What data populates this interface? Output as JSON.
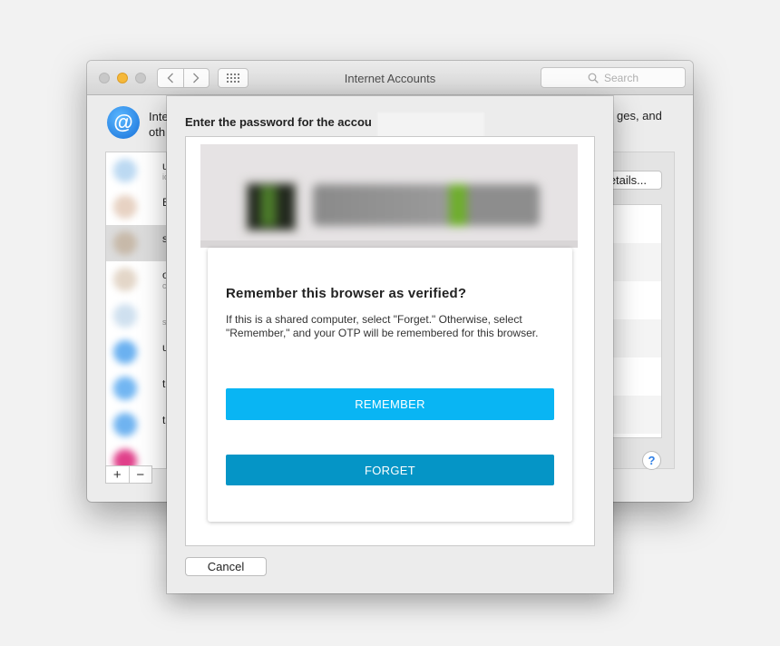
{
  "window": {
    "title": "Internet Accounts",
    "search_placeholder": "Search",
    "description_left": "Inte",
    "description_left_line2": "oth",
    "description_right": "ges, and",
    "details_label": "etails...",
    "help_label": "?",
    "add_label": "+",
    "remove_label": "−",
    "account_fragments": [
      {
        "main": "u",
        "sub": "ic"
      },
      {
        "main": "E",
        "sub": ""
      },
      {
        "main": "s",
        "sub": ""
      },
      {
        "main": "o",
        "sub": "c"
      },
      {
        "main": "",
        "sub": "s"
      },
      {
        "main": "u",
        "sub": ""
      },
      {
        "main": "t",
        "sub": ""
      },
      {
        "main": "ta",
        "sub": ""
      }
    ]
  },
  "sheet": {
    "title": "Enter the password for the accou",
    "card": {
      "heading": "Remember this browser as verified?",
      "body": "If this is a shared computer, select \"Forget.\" Otherwise, select \"Remember,\" and your OTP will be remembered for this browser.",
      "remember_label": "REMEMBER",
      "forget_label": "FORGET"
    },
    "cancel_label": "Cancel"
  },
  "colors": {
    "remember_button": "#09b5f3",
    "forget_button": "#0595c6",
    "minimize_light": "#f5b83a",
    "accent_blue": "#2e7fe6"
  }
}
